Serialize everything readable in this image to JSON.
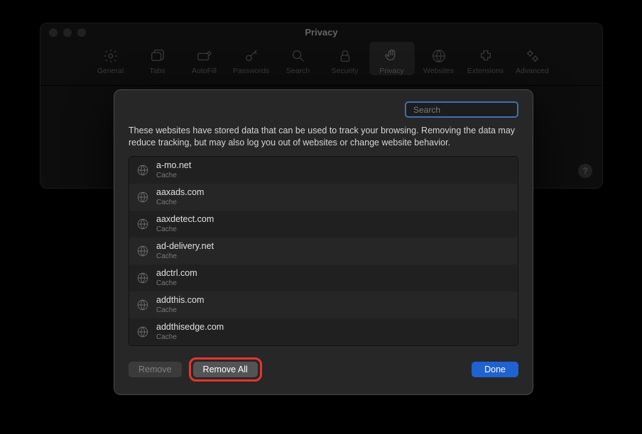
{
  "window": {
    "title": "Privacy"
  },
  "tabs": {
    "general": "General",
    "tabs": "Tabs",
    "autofill": "AutoFill",
    "passwords": "Passwords",
    "search": "Search",
    "security": "Security",
    "privacy": "Privacy",
    "websites": "Websites",
    "extensions": "Extensions",
    "advanced": "Advanced"
  },
  "help_glyph": "?",
  "sheet": {
    "search_placeholder": "Search",
    "description": "These websites have stored data that can be used to track your browsing. Removing the data may reduce tracking, but may also log you out of websites or change website behavior.",
    "sites": [
      {
        "domain": "a-mo.net",
        "detail": "Cache"
      },
      {
        "domain": "aaxads.com",
        "detail": "Cache"
      },
      {
        "domain": "aaxdetect.com",
        "detail": "Cache"
      },
      {
        "domain": "ad-delivery.net",
        "detail": "Cache"
      },
      {
        "domain": "adctrl.com",
        "detail": "Cache"
      },
      {
        "domain": "addthis.com",
        "detail": "Cache"
      },
      {
        "domain": "addthisedge.com",
        "detail": "Cache"
      }
    ],
    "buttons": {
      "remove": "Remove",
      "remove_all": "Remove All",
      "done": "Done"
    }
  }
}
